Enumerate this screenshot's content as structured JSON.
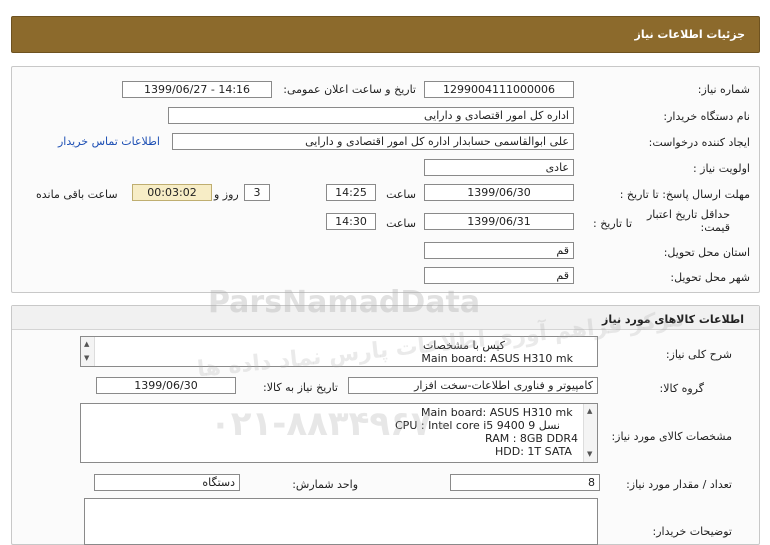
{
  "header": {
    "title": "جزئیات اطلاعات نیاز"
  },
  "need": {
    "need_number_label": "شماره نیاز:",
    "need_number": "1299004111000006",
    "announce_label": "تاریخ و ساعت اعلان عمومی:",
    "announce_value": "1399/06/27 - 14:16",
    "buyer_org_label": "نام دستگاه خریدار:",
    "buyer_org": "اداره کل امور اقتصادی و دارایی",
    "requester_label": "ایجاد کننده درخواست:",
    "requester": "علی ابوالقاسمی حسابدار اداره کل امور اقتصادی و دارایی",
    "contact_link": "اطلاعات تماس خریدار",
    "priority_label": "اولویت نیاز :",
    "priority": "عادی",
    "deadline_label": "مهلت ارسال پاسخ:  تا تاریخ :",
    "deadline_date": "1399/06/30",
    "time_label": "ساعت",
    "deadline_time": "14:25",
    "days_count": "3",
    "days_label": "روز و",
    "remaining_time": "00:03:02",
    "remaining_label": "ساعت باقی مانده",
    "validity_label": "حداقل تاریخ اعتبار قیمت:",
    "validity_to_label": "تا تاریخ :",
    "validity_date": "1399/06/31",
    "validity_time_label": "ساعت",
    "validity_time": "14:30",
    "province_label": "استان محل تحویل:",
    "province": "قم",
    "city_label": "شهر محل تحویل:",
    "city": "قم"
  },
  "goods": {
    "section_title": "اطلاعات کالاهای مورد نیاز",
    "summary_label": "شرح کلی نیاز:",
    "summary_lines": [
      "کیس با مشخصات",
      "Main board: ASUS H310 mk"
    ],
    "group_label": "گروه کالا:",
    "group": "کامپیوتر و فناوری اطلاعات-سخت افزار",
    "need_date_label": "تاریخ نیاز به کالا:",
    "need_date": "1399/06/30",
    "spec_label": "مشخصات کالای مورد نیاز:",
    "spec_lines": [
      "Main board: ASUS H310 mk",
      "CPU : Intel core i5 9400  نسل 9",
      "RAM : 8GB DDR4",
      "HDD: 1T  SATA"
    ],
    "qty_label": "تعداد / مقدار مورد نیاز:",
    "qty": "8",
    "unit_label": "واحد شمارش:",
    "unit": "دستگاه",
    "buyer_notes_label": "توضیحات خریدار:"
  },
  "watermark": {
    "brand": "ParsNamadData",
    "tagline": "مرکز فراهم آوری اطلاعات پارس نماد داده ها",
    "phone": "۰۲۱-۸۸۳۴۹۶۷۰"
  },
  "colors": {
    "title_bar": "#8c6a2c",
    "link": "#1d4fb4",
    "remaining_bg": "#f7edc6"
  }
}
